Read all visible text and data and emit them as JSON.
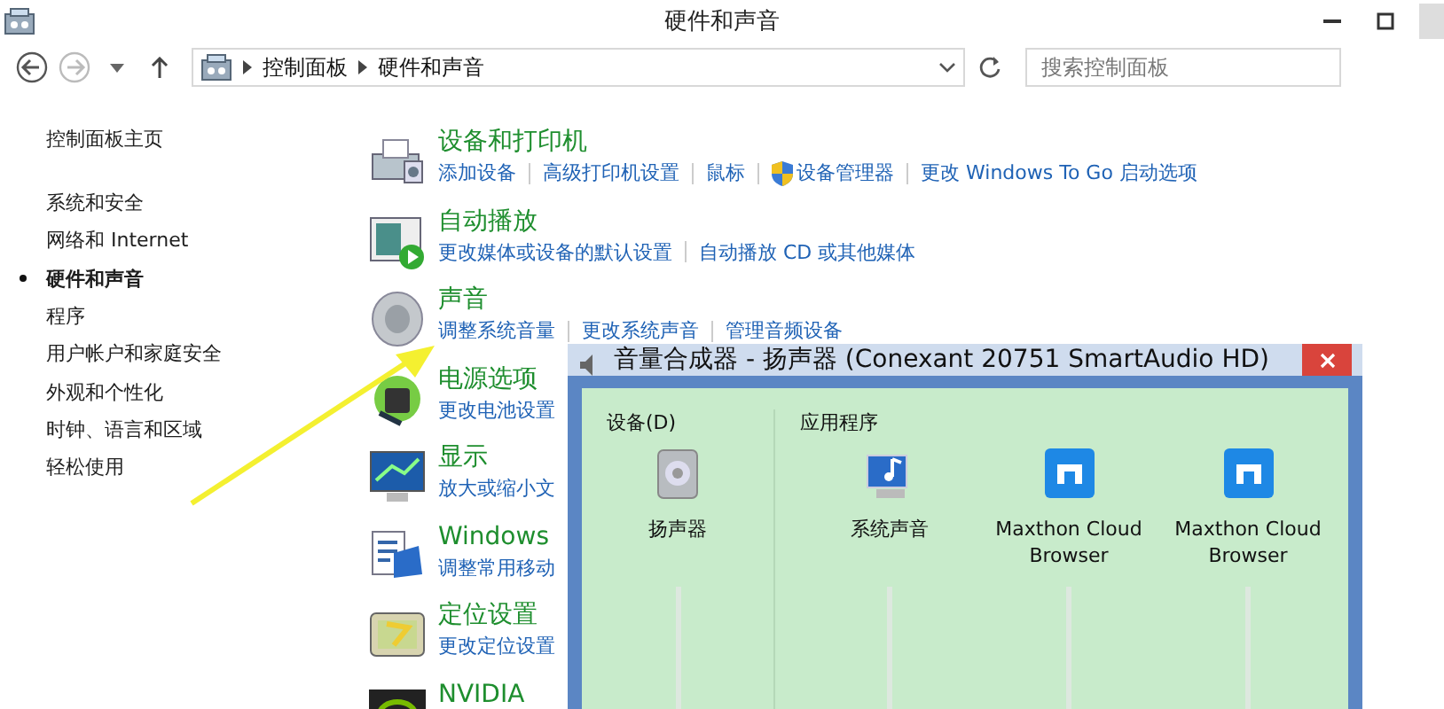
{
  "window": {
    "title": "硬件和声音"
  },
  "address_bar": {
    "breadcrumbs": [
      "控制面板",
      "硬件和声音"
    ],
    "forward_disabled": true
  },
  "search": {
    "placeholder": "搜索控制面板"
  },
  "sidebar": {
    "home": "控制面板主页",
    "items": [
      {
        "label": "系统和安全",
        "selected": false
      },
      {
        "label": "网络和 Internet",
        "selected": false
      },
      {
        "label": "硬件和声音",
        "selected": true
      },
      {
        "label": "程序",
        "selected": false
      },
      {
        "label": "用户帐户和家庭安全",
        "selected": false
      },
      {
        "label": "外观和个性化",
        "selected": false
      },
      {
        "label": "时钟、语言和区域",
        "selected": false
      },
      {
        "label": "轻松使用",
        "selected": false
      }
    ]
  },
  "categories": [
    {
      "title": "设备和打印机",
      "links": [
        {
          "label": "添加设备"
        },
        {
          "label": "高级打印机设置"
        },
        {
          "label": "鼠标"
        },
        {
          "label": "设备管理器",
          "shield": true
        },
        {
          "label": "更改 Windows To Go 启动选项"
        }
      ]
    },
    {
      "title": "自动播放",
      "links": [
        {
          "label": "更改媒体或设备的默认设置"
        },
        {
          "label": "自动播放 CD 或其他媒体"
        }
      ]
    },
    {
      "title": "声音",
      "links": [
        {
          "label": "调整系统音量"
        },
        {
          "label": "更改系统声音"
        },
        {
          "label": "管理音频设备"
        }
      ]
    },
    {
      "title": "电源选项",
      "links": [
        {
          "label": "更改电池设置"
        }
      ]
    },
    {
      "title": "显示",
      "links": [
        {
          "label": "放大或缩小文"
        }
      ]
    },
    {
      "title": "Windows",
      "links": [
        {
          "label": "调整常用移动"
        }
      ]
    },
    {
      "title": "定位设置",
      "links": [
        {
          "label": "更改定位设置"
        }
      ]
    },
    {
      "title": "NVIDIA"
    }
  ],
  "mixer": {
    "title": "音量合成器 - 扬声器 (Conexant 20751 SmartAudio HD)",
    "device_heading": "设备(D)",
    "apps_heading": "应用程序",
    "device": {
      "name": "扬声器"
    },
    "apps": [
      {
        "name": "系统声音",
        "kind": "system"
      },
      {
        "name": "Maxthon Cloud Browser",
        "kind": "browser"
      },
      {
        "name": "Maxthon Cloud Browser",
        "kind": "browser"
      }
    ]
  }
}
